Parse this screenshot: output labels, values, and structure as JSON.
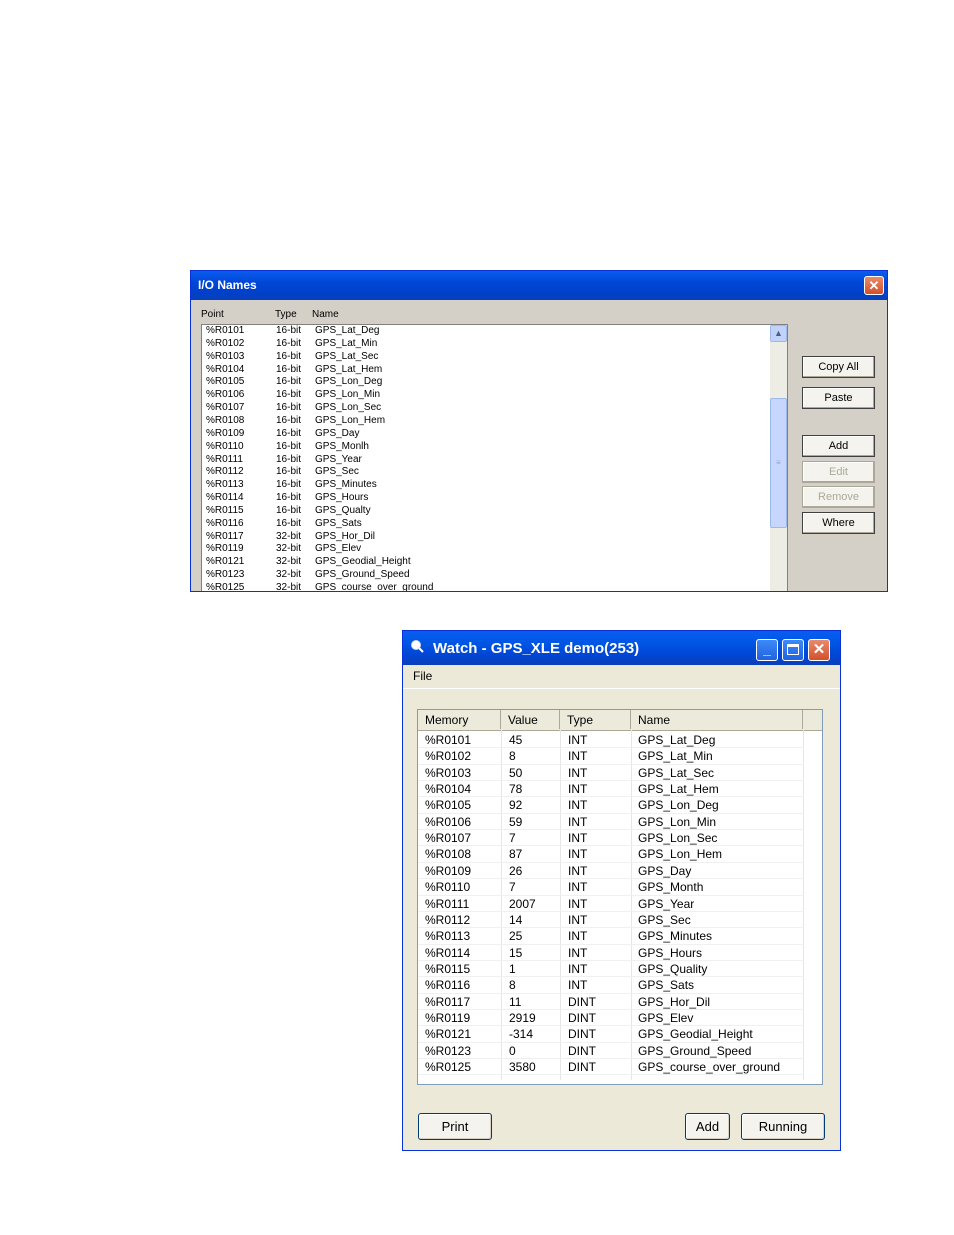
{
  "io_window": {
    "title": "I/O Names",
    "close_glyph": "✕",
    "columns": {
      "point": "Point",
      "type": "Type",
      "name": "Name"
    },
    "rows": [
      {
        "point": "%R0101",
        "type": "16-bit",
        "name": "GPS_Lat_Deg"
      },
      {
        "point": "%R0102",
        "type": "16-bit",
        "name": "GPS_Lat_Min"
      },
      {
        "point": "%R0103",
        "type": "16-bit",
        "name": "GPS_Lat_Sec"
      },
      {
        "point": "%R0104",
        "type": "16-bit",
        "name": "GPS_Lat_Hem"
      },
      {
        "point": "%R0105",
        "type": "16-bit",
        "name": "GPS_Lon_Deg"
      },
      {
        "point": "%R0106",
        "type": "16-bit",
        "name": "GPS_Lon_Min"
      },
      {
        "point": "%R0107",
        "type": "16-bit",
        "name": "GPS_Lon_Sec"
      },
      {
        "point": "%R0108",
        "type": "16-bit",
        "name": "GPS_Lon_Hem"
      },
      {
        "point": "%R0109",
        "type": "16-bit",
        "name": "GPS_Day"
      },
      {
        "point": "%R0110",
        "type": "16-bit",
        "name": "GPS_Monlh"
      },
      {
        "point": "%R0111",
        "type": "16-bit",
        "name": "GPS_Year"
      },
      {
        "point": "%R0112",
        "type": "16-bit",
        "name": "GPS_Sec"
      },
      {
        "point": "%R0113",
        "type": "16-bit",
        "name": "GPS_Minutes"
      },
      {
        "point": "%R0114",
        "type": "16-bit",
        "name": "GPS_Hours"
      },
      {
        "point": "%R0115",
        "type": "16-bit",
        "name": "GPS_Qualty"
      },
      {
        "point": "%R0116",
        "type": "16-bit",
        "name": "GPS_Sats"
      },
      {
        "point": "%R0117",
        "type": "32-bit",
        "name": "GPS_Hor_Dil"
      },
      {
        "point": "%R0119",
        "type": "32-bit",
        "name": "GPS_Elev"
      },
      {
        "point": "%R0121",
        "type": "32-bit",
        "name": "GPS_Geodial_Height"
      },
      {
        "point": "%R0123",
        "type": "32-bit",
        "name": "GPS_Ground_Speed"
      },
      {
        "point": "%R0125",
        "type": "32-bit",
        "name": "GPS_course_over_ground"
      }
    ],
    "scroll_up_glyph": "▲",
    "scroll_grip_glyph": "≡",
    "buttons": {
      "copy_all": "Copy All",
      "paste": "Paste",
      "add": "Add",
      "edit": "Edit",
      "remove": "Remove",
      "where": "Where"
    }
  },
  "watch_window": {
    "title": "Watch - GPS_XLE demo(253)",
    "minimize_glyph": "_",
    "close_glyph": "✕",
    "menu": {
      "file": "File"
    },
    "columns": {
      "memory": "Memory",
      "value": "Value",
      "type": "Type",
      "name": "Name"
    },
    "rows": [
      {
        "memory": "%R0101",
        "value": "45",
        "type": "INT",
        "name": "GPS_Lat_Deg"
      },
      {
        "memory": "%R0102",
        "value": "8",
        "type": "INT",
        "name": "GPS_Lat_Min"
      },
      {
        "memory": "%R0103",
        "value": "50",
        "type": "INT",
        "name": "GPS_Lat_Sec"
      },
      {
        "memory": "%R0104",
        "value": "78",
        "type": "INT",
        "name": "GPS_Lat_Hem"
      },
      {
        "memory": "%R0105",
        "value": "92",
        "type": "INT",
        "name": "GPS_Lon_Deg"
      },
      {
        "memory": "%R0106",
        "value": "59",
        "type": "INT",
        "name": "GPS_Lon_Min"
      },
      {
        "memory": "%R0107",
        "value": "7",
        "type": "INT",
        "name": "GPS_Lon_Sec"
      },
      {
        "memory": "%R0108",
        "value": "87",
        "type": "INT",
        "name": "GPS_Lon_Hem"
      },
      {
        "memory": "%R0109",
        "value": "26",
        "type": "INT",
        "name": "GPS_Day"
      },
      {
        "memory": "%R0110",
        "value": "7",
        "type": "INT",
        "name": "GPS_Month"
      },
      {
        "memory": "%R0111",
        "value": "2007",
        "type": "INT",
        "name": "GPS_Year"
      },
      {
        "memory": "%R0112",
        "value": "14",
        "type": "INT",
        "name": "GPS_Sec"
      },
      {
        "memory": "%R0113",
        "value": "25",
        "type": "INT",
        "name": "GPS_Minutes"
      },
      {
        "memory": "%R0114",
        "value": "15",
        "type": "INT",
        "name": "GPS_Hours"
      },
      {
        "memory": "%R0115",
        "value": "1",
        "type": "INT",
        "name": "GPS_Quality"
      },
      {
        "memory": "%R0116",
        "value": "8",
        "type": "INT",
        "name": "GPS_Sats"
      },
      {
        "memory": "%R0117",
        "value": "11",
        "type": "DINT",
        "name": "GPS_Hor_Dil"
      },
      {
        "memory": "%R0119",
        "value": "2919",
        "type": "DINT",
        "name": "GPS_Elev"
      },
      {
        "memory": "%R0121",
        "value": "-314",
        "type": "DINT",
        "name": "GPS_Geodial_Height"
      },
      {
        "memory": "%R0123",
        "value": "0",
        "type": "DINT",
        "name": "GPS_Ground_Speed"
      },
      {
        "memory": "%R0125",
        "value": "3580",
        "type": "DINT",
        "name": "GPS_course_over_ground"
      }
    ],
    "buttons": {
      "print": "Print",
      "add": "Add",
      "running": "Running"
    }
  }
}
